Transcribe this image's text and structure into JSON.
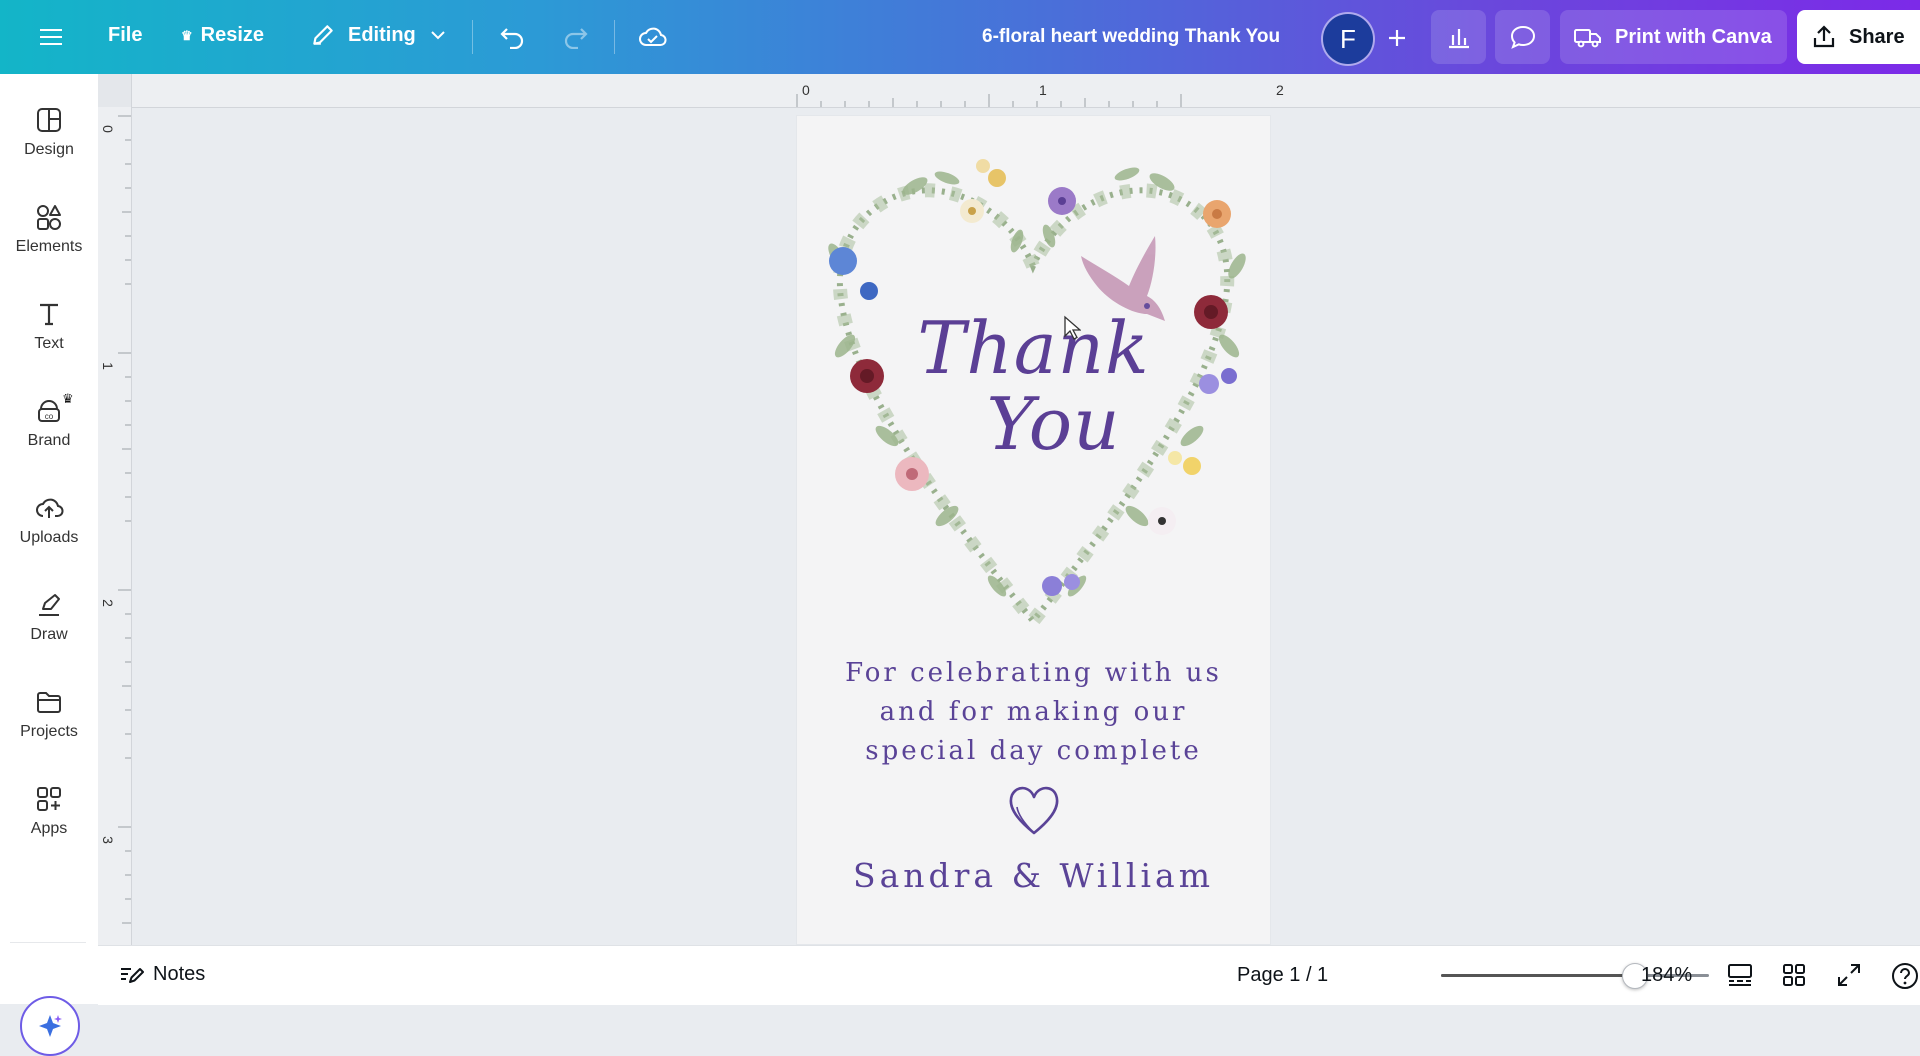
{
  "topbar": {
    "menu_icon": "hamburger-icon",
    "file_label": "File",
    "resize_label": "Resize",
    "editing_label": "Editing",
    "doc_title": "6-floral heart wedding  Thank You",
    "avatar_letter": "F",
    "print_label": "Print with Canva",
    "share_label": "Share",
    "gradient_colors": [
      "#13b5c8",
      "#4a6fd9",
      "#7c2ae8"
    ]
  },
  "sidebar": {
    "items": [
      {
        "label": "Design",
        "icon": "layout-icon"
      },
      {
        "label": "Elements",
        "icon": "shapes-icon"
      },
      {
        "label": "Text",
        "icon": "text-icon"
      },
      {
        "label": "Brand",
        "icon": "brand-icon"
      },
      {
        "label": "Uploads",
        "icon": "cloud-upload-icon"
      },
      {
        "label": "Draw",
        "icon": "draw-icon"
      },
      {
        "label": "Projects",
        "icon": "folder-icon"
      },
      {
        "label": "Apps",
        "icon": "apps-icon"
      }
    ],
    "brand_badge": "♛"
  },
  "ruler": {
    "top": [
      "0",
      "1",
      "2"
    ],
    "left": [
      "0",
      "1",
      "2",
      "3"
    ]
  },
  "design": {
    "script_line1": "Thank",
    "script_line2": "You",
    "message": "For celebrating with us and for making our special day complete",
    "names": "Sandra & William",
    "text_color": "#5a4397",
    "page_color": "#f4f4f5"
  },
  "bottombar": {
    "notes_label": "Notes",
    "page_indicator": "Page 1 / 1",
    "zoom": "184%",
    "zoom_slider_fraction": 0.72
  }
}
